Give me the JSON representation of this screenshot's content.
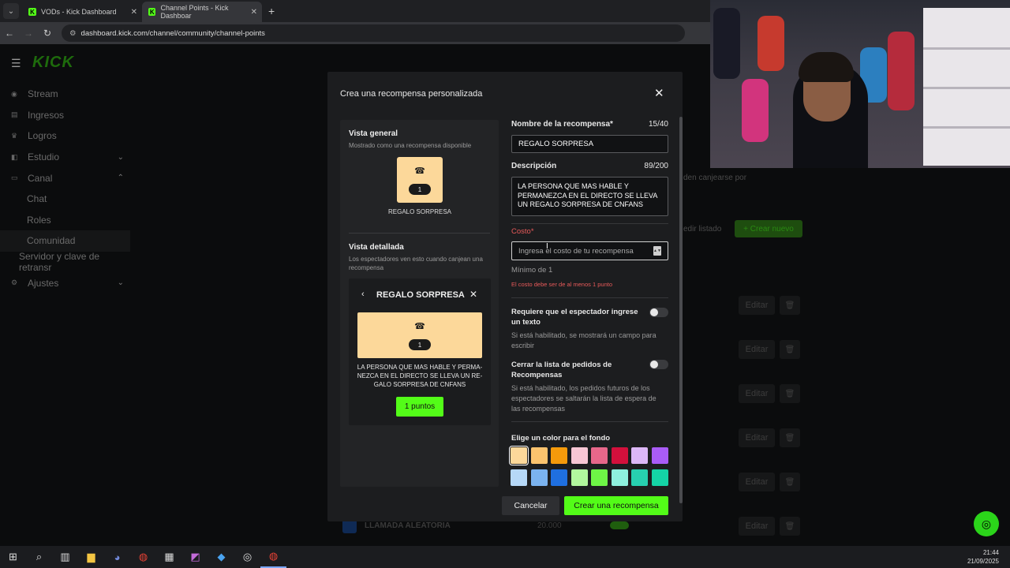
{
  "browser": {
    "tabs": [
      {
        "title": "VODs - Kick Dashboard"
      },
      {
        "title": "Channel Points - Kick Dashboar"
      }
    ],
    "url": "dashboard.kick.com/channel/community/channel-points"
  },
  "header": {
    "logo": "KICK"
  },
  "sidebar": {
    "items": [
      {
        "label": "Stream"
      },
      {
        "label": "Ingresos"
      },
      {
        "label": "Logros"
      },
      {
        "label": "Estudio"
      },
      {
        "label": "Canal"
      },
      {
        "label": "Chat"
      },
      {
        "label": "Roles"
      },
      {
        "label": "Comunidad"
      },
      {
        "label": "Servidor y clave de retransr"
      },
      {
        "label": "Ajustes"
      }
    ]
  },
  "background": {
    "partial_text": "den canjearse por",
    "edit_list": "edir listado",
    "create_new": "Crear nuevo",
    "edit_label": "Editar",
    "row_name": "LLAMADA ALEATORIA",
    "row_cost": "20.000"
  },
  "modal": {
    "title": "Crea una recompensa personalizada",
    "preview": {
      "general_title": "Vista general",
      "general_sub": "Mostrado como una recompensa disponible",
      "card_count": "1",
      "card_label": "REGALO SORPRESA",
      "detail_title": "Vista detallada",
      "detail_sub": "Los espectadores ven esto cuando canjean una recompensa",
      "detail_name": "REGALO SORPRESA",
      "detail_count": "1",
      "detail_desc": "LA PERSONA QUE MAS HABLE Y PERMA-NEZCA EN EL DIRECTO SE LLEVA UN RE-GALO SORPRESA DE CNFANS",
      "points_button": "1 puntos"
    },
    "form": {
      "name_label": "Nombre de la recompensa*",
      "name_counter": "15/40",
      "name_value": "REGALO SORPRESA",
      "desc_label": "Descripción",
      "desc_counter": "89/200",
      "desc_value": "LA PERSONA QUE MAS HABLE Y PERMANEZCA EN EL DIRECTO SE LLEVA UN REGALO SORPRESA DE CNFANS",
      "cost_label": "Costo*",
      "cost_placeholder": "Ingresa el costo de tu recompensa",
      "cost_min": "Mínimo de 1",
      "cost_error": "El costo debe ser de al menos 1 punto",
      "require_text_title": "Requiere que el espectador ingrese un texto",
      "require_text_desc": "Si está habilitado, se mostrará un campo para escribir",
      "close_queue_title": "Cerrar la lista de pedidos de Recompensas",
      "close_queue_desc": "Si está habilitado, los pedidos futuros de los espectadores se saltarán la lista de espera de las recompensas",
      "colors_title": "Elige un color para el fondo",
      "colors": [
        "#fcd89a",
        "#fbc36e",
        "#f59a0b",
        "#f7c6d4",
        "#e7678a",
        "#d3103c",
        "#dcb7f7",
        "#a95cf6",
        "#b6d8f7",
        "#7bb3ef",
        "#1f6fe0",
        "#b2f79e",
        "#6ef546",
        "#8ef0de",
        "#27d0b0",
        "#14d4a6"
      ]
    },
    "cancel_label": "Cancelar",
    "create_label": "Crear una recompensa"
  },
  "taskbar": {
    "time": "21:44",
    "date": "21/09/2025"
  }
}
